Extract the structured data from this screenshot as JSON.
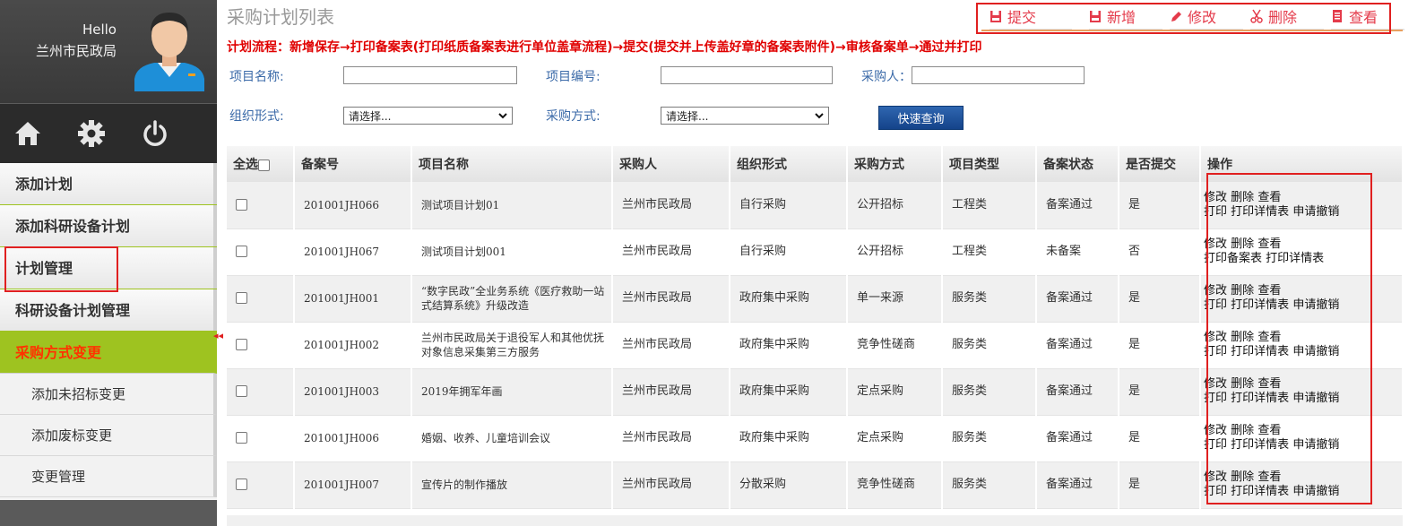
{
  "user": {
    "greeting": "Hello",
    "org": "兰州市民政局"
  },
  "icon_bar": [
    "home-icon",
    "gear-icon",
    "power-icon"
  ],
  "menu": {
    "items": [
      "添加计划",
      "添加科研设备计划",
      "计划管理",
      "科研设备计划管理",
      "采购方式变更"
    ],
    "sub_items": [
      "添加未招标变更",
      "添加废标变更",
      "变更管理"
    ]
  },
  "page": {
    "title": "采购计划列表",
    "process_note": "计划流程：新增保存→打印备案表(打印纸质备案表进行单位盖章流程)→提交(提交并上传盖好章的备案表附件)→审核备案单→通过并打印"
  },
  "toolbar": {
    "submit": "提交",
    "add": "新增",
    "edit": "修改",
    "delete": "删除",
    "view": "查看"
  },
  "search": {
    "project_name_label": "项目名称:",
    "project_name_value": "",
    "project_code_label": "项目编号:",
    "project_code_value": "",
    "purchaser_label": "采购人：",
    "purchaser_value": "",
    "org_form_label": "组织形式:",
    "org_form_selected": "请选择...",
    "purchase_method_label": "采购方式:",
    "purchase_method_selected": "请选择...",
    "query_button": "快速查询"
  },
  "table": {
    "select_all": "全选",
    "headers": [
      "备案号",
      "项目名称",
      "采购人",
      "组织形式",
      "采购方式",
      "项目类型",
      "备案状态",
      "是否提交",
      "操作"
    ],
    "rows": [
      {
        "code": "201001JH066",
        "name": "测试项目计划01",
        "purchaser": "兰州市民政局",
        "org_form": "自行采购",
        "method": "公开招标",
        "type": "工程类",
        "status": "备案通过",
        "submitted": "是",
        "ops_line1": [
          "修改",
          "删除",
          "查看"
        ],
        "ops_line2": [
          "打印",
          "打印详情表",
          "申请撤销"
        ]
      },
      {
        "code": "201001JH067",
        "name": "测试项目计划001",
        "purchaser": "兰州市民政局",
        "org_form": "自行采购",
        "method": "公开招标",
        "type": "工程类",
        "status": "未备案",
        "submitted": "否",
        "ops_line1": [
          "修改",
          "删除",
          "查看"
        ],
        "ops_line2": [
          "打印备案表",
          "打印详情表"
        ]
      },
      {
        "code": "201001JH001",
        "name": "“数字民政”全业务系统《医疗救助一站式结算系统》升级改造",
        "purchaser": "兰州市民政局",
        "org_form": "政府集中采购",
        "method": "单一来源",
        "type": "服务类",
        "status": "备案通过",
        "submitted": "是",
        "ops_line1": [
          "修改",
          "删除",
          "查看"
        ],
        "ops_line2": [
          "打印",
          "打印详情表",
          "申请撤销"
        ]
      },
      {
        "code": "201001JH002",
        "name": "兰州市民政局关于退役军人和其他优抚对象信息采集第三方服务",
        "purchaser": "兰州市民政局",
        "org_form": "政府集中采购",
        "method": "竞争性磋商",
        "type": "服务类",
        "status": "备案通过",
        "submitted": "是",
        "ops_line1": [
          "修改",
          "删除",
          "查看"
        ],
        "ops_line2": [
          "打印",
          "打印详情表",
          "申请撤销"
        ]
      },
      {
        "code": "201001JH003",
        "name": "2019年拥军年画",
        "purchaser": "兰州市民政局",
        "org_form": "政府集中采购",
        "method": "定点采购",
        "type": "服务类",
        "status": "备案通过",
        "submitted": "是",
        "ops_line1": [
          "修改",
          "删除",
          "查看"
        ],
        "ops_line2": [
          "打印",
          "打印详情表",
          "申请撤销"
        ]
      },
      {
        "code": "201001JH006",
        "name": "婚姻、收养、儿童培训会议",
        "purchaser": "兰州市民政局",
        "org_form": "政府集中采购",
        "method": "定点采购",
        "type": "服务类",
        "status": "备案通过",
        "submitted": "是",
        "ops_line1": [
          "修改",
          "删除",
          "查看"
        ],
        "ops_line2": [
          "打印",
          "打印详情表",
          "申请撤销"
        ]
      },
      {
        "code": "201001JH007",
        "name": "宣传片的制作播放",
        "purchaser": "兰州市民政局",
        "org_form": "分散采购",
        "method": "竞争性磋商",
        "type": "服务类",
        "status": "备案通过",
        "submitted": "是",
        "ops_line1": [
          "修改",
          "删除",
          "查看"
        ],
        "ops_line2": [
          "打印",
          "打印详情表",
          "申请撤销"
        ]
      }
    ]
  },
  "colors": {
    "menu_active_bg": "#9ec320",
    "menu_active_text": "#ff3300",
    "toolbar_text": "#e43b4b",
    "highlight_box": "#e02020",
    "query_button": "#1f569e"
  }
}
